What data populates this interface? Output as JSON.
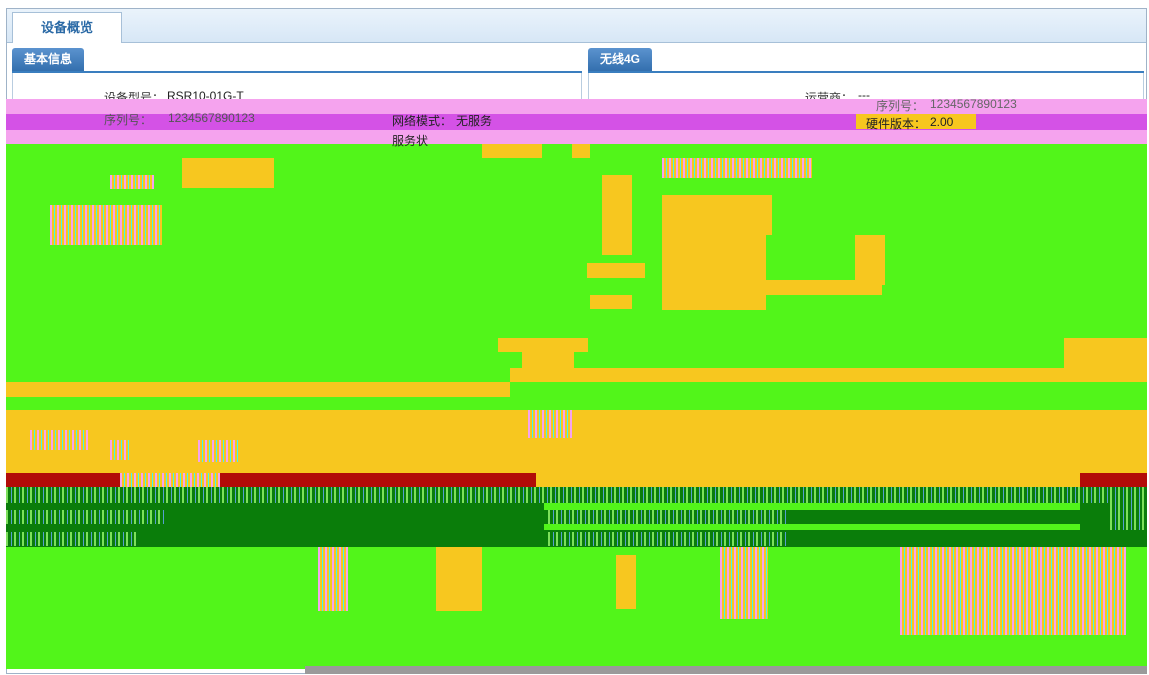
{
  "tabs": {
    "overview": "设备概览"
  },
  "basic_info": {
    "title": "基本信息",
    "model_label": "设备型号：",
    "model_value": "RSR10-01G-T",
    "serial_label": "序列号：",
    "serial_value": "1234567890123"
  },
  "wireless": {
    "title": "无线4G",
    "carrier_label": "运营商：",
    "carrier_value": "---",
    "network_mode_label": "网络模式：",
    "network_mode_value": "无服务",
    "service_status_label": "服务状",
    "serial_label": "序列号：",
    "serial_value": "1234567890123",
    "hw_version_label": "硬件版本：",
    "hw_version_value": "2.00"
  }
}
